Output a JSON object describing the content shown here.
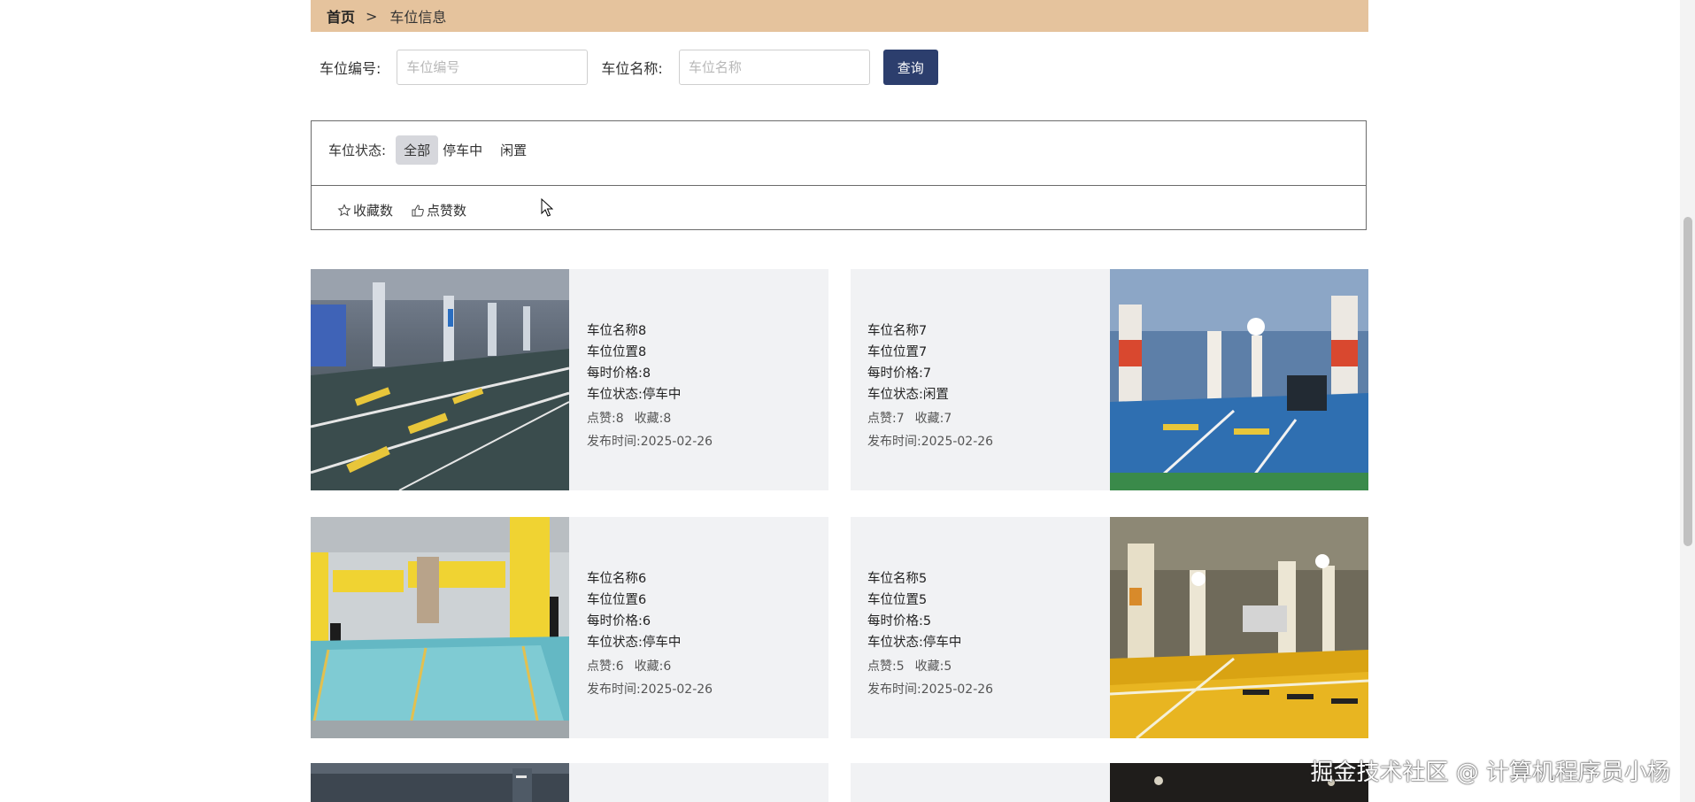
{
  "breadcrumb": {
    "home": "首页",
    "separator": ">",
    "current": "车位信息"
  },
  "search": {
    "code_label": "车位编号:",
    "code_placeholder": "车位编号",
    "code_value": "",
    "name_label": "车位名称:",
    "name_placeholder": "车位名称",
    "name_value": "",
    "query_label": "查询"
  },
  "filter": {
    "status_label": "车位状态:",
    "options": [
      "全部",
      "停车中",
      "闲置"
    ],
    "selected": "全部"
  },
  "sort": {
    "favorites_label": "收藏数",
    "likes_label": "点赞数",
    "favorites_icon": "star-outline-icon",
    "likes_icon": "thumbs-up-outline-icon"
  },
  "cards": [
    {
      "name": "车位名称8",
      "location": "车位位置8",
      "price": "每时价格:8",
      "status": "车位状态:停车中",
      "likes_label": "点赞:",
      "likes": "8",
      "fav_label": "收藏:",
      "favs": "8",
      "date": "发布时间:2025-02-26"
    },
    {
      "name": "车位名称7",
      "location": "车位位置7",
      "price": "每时价格:7",
      "status": "车位状态:闲置",
      "likes_label": "点赞:",
      "likes": "7",
      "fav_label": "收藏:",
      "favs": "7",
      "date": "发布时间:2025-02-26"
    },
    {
      "name": "车位名称6",
      "location": "车位位置6",
      "price": "每时价格:6",
      "status": "车位状态:停车中",
      "likes_label": "点赞:",
      "likes": "6",
      "fav_label": "收藏:",
      "favs": "6",
      "date": "发布时间:2025-02-26"
    },
    {
      "name": "车位名称5",
      "location": "车位位置5",
      "price": "每时价格:5",
      "status": "车位状态:停车中",
      "likes_label": "点赞:",
      "likes": "5",
      "fav_label": "收藏:",
      "favs": "5",
      "date": "发布时间:2025-02-26"
    }
  ],
  "watermark": "掘金技术社区 @ 计算机程序员小杨",
  "colors": {
    "breadcrumb_bg": "#e5c39d",
    "button_bg": "#2c3e6d",
    "card_bg": "#f1f2f4"
  }
}
